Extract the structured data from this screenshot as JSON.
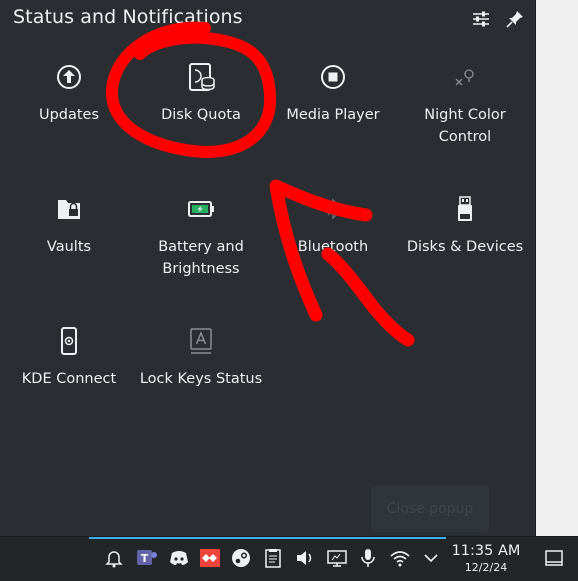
{
  "popup": {
    "title": "Status and Notifications",
    "header_buttons": [
      "configure-icon",
      "pin-icon"
    ],
    "close_label": "Close popup"
  },
  "tiles": [
    {
      "label": "Updates",
      "icon": "update-icon"
    },
    {
      "label": "Disk Quota",
      "icon": "disk-quota-icon"
    },
    {
      "label": "Media Player",
      "icon": "media-player-icon"
    },
    {
      "label": "Night Color Control",
      "icon": "night-color-icon"
    },
    {
      "label": "Vaults",
      "icon": "vault-icon"
    },
    {
      "label": "Battery and Brightness",
      "icon": "battery-icon"
    },
    {
      "label": "Bluetooth",
      "icon": "bluetooth-icon"
    },
    {
      "label": "Disks & Devices",
      "icon": "disk-device-icon"
    },
    {
      "label": "KDE Connect",
      "icon": "kde-connect-icon"
    },
    {
      "label": "Lock Keys Status",
      "icon": "lock-keys-icon"
    }
  ],
  "taskbar": {
    "time": "11:35 AM",
    "date": "12/2/24",
    "tray_icons": [
      "notification-bell-icon",
      "teams-icon",
      "discord-icon",
      "anydesk-icon",
      "steam-icon",
      "clipboard-icon",
      "volume-icon",
      "display-icon",
      "microphone-icon",
      "wifi-icon",
      "expand-tray-icon",
      "show-desktop-icon"
    ]
  },
  "colors": {
    "popup_bg": "#2a2e32",
    "taskbar_bg": "#232629",
    "text": "#eff0f1",
    "accent": "#3daee9",
    "annotation": "#ff0000"
  }
}
